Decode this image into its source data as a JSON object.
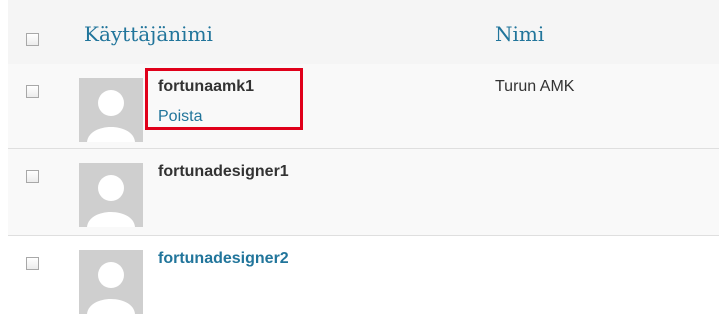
{
  "header": {
    "username_label": "Käyttäjänimi",
    "name_label": "Nimi"
  },
  "users": [
    {
      "username": "fortunaamk1",
      "action": "Poista",
      "name": "Turun AMK"
    },
    {
      "username": "fortunadesigner1",
      "name": ""
    },
    {
      "username": "fortunadesigner2",
      "name": ""
    }
  ],
  "annotation": {
    "color": "#e0001a",
    "target": "users.0"
  },
  "colors": {
    "link": "#21759b",
    "text": "#333333",
    "header_bg": "#f5f5f5",
    "row_alt_bg": "#f9f9f9"
  },
  "icons": {
    "avatar": "avatar-placeholder-icon"
  }
}
